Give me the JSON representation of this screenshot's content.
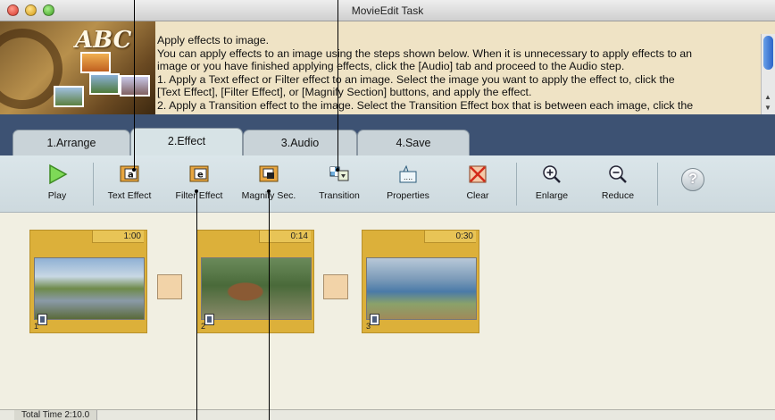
{
  "window": {
    "title": "MovieEdit Task"
  },
  "banner": {
    "logo_text": "ABC"
  },
  "instructions": {
    "heading": "Apply effects to image.",
    "line1": "You can apply effects to an image using the steps shown below. When it is unnecessary to apply effects to an",
    "line2": "image or you have finished applying effects, click the [Audio] tab and proceed to the Audio step.",
    "line3": "1. Apply a Text effect or Filter effect to an image. Select the image you want to apply the effect to, click the",
    "line4": "[Text Effect], [Filter Effect], or [Magnify Section] buttons, and apply the effect.",
    "line5": "2. Apply a Transition effect to the image. Select the Transition Effect box that is between each image, click the"
  },
  "tabs": [
    {
      "label": "1.Arrange",
      "active": false
    },
    {
      "label": "2.Effect",
      "active": true
    },
    {
      "label": "3.Audio",
      "active": false
    },
    {
      "label": "4.Save",
      "active": false
    }
  ],
  "toolbar": {
    "play": "Play",
    "text_effect": "Text Effect",
    "filter_effect": "Filter Effect",
    "magnify": "Magnify Sec.",
    "transition": "Transition",
    "properties": "Properties",
    "clear": "Clear",
    "enlarge": "Enlarge",
    "reduce": "Reduce",
    "help": "?"
  },
  "clips": [
    {
      "number": "1",
      "duration": "1:00"
    },
    {
      "number": "2",
      "duration": "0:14"
    },
    {
      "number": "3",
      "duration": "0:30"
    }
  ],
  "status": {
    "total_time": "Total Time  2:10.0"
  },
  "colors": {
    "tabbar": "#3d5273",
    "clip_frame": "#dcb03a",
    "workarea": "#f1efe2",
    "header_bg": "#efe3c5"
  },
  "icons": [
    "play-icon",
    "text-effect-icon",
    "filter-effect-icon",
    "magnify-icon",
    "transition-icon",
    "properties-icon",
    "clear-icon",
    "enlarge-icon",
    "reduce-icon",
    "help-icon",
    "film-icon"
  ]
}
